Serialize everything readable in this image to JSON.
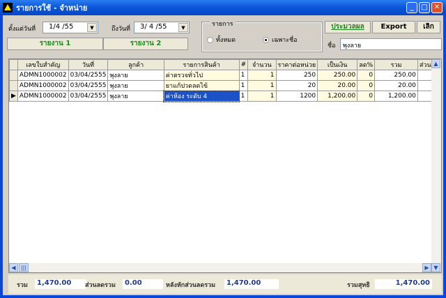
{
  "window": {
    "title": "รายการใช้ - จำหน่าย"
  },
  "filters": {
    "from_label": "ตั้งแต่วันที่",
    "from_value": "1/4 /55",
    "to_label": "ถึงวันที่",
    "to_value": "3/ 4 /55",
    "report1": "รายงาน 1",
    "report2": "รายงาน 2",
    "group_label": "รายการ",
    "radio_all": "ทั้งหมด",
    "radio_name": "เฉพาะชื่อ",
    "selected": "เฉพาะชื่อ",
    "process": "ประมวลผล",
    "export": "Export",
    "cancel": "เลิก",
    "name_label": "ชื่อ",
    "name_value": "พุงลาย"
  },
  "grid": {
    "columns": [
      "เลขใบสำคัญ",
      "วันที่",
      "ลูกค้า",
      "รายการสินค้า",
      "#",
      "จำนวน",
      "ราคาต่อหน่วย",
      "เป็นเงิน",
      "ลด%",
      "รวม",
      "ส่วนลด"
    ],
    "rows": [
      [
        "ADMN1000002",
        "03/04/2555",
        "พุงลาย",
        "ค่าตรวจทั่วไป",
        "1",
        "1",
        "250",
        "250.00",
        "0",
        "250.00",
        ""
      ],
      [
        "ADMN1000002",
        "03/04/2555",
        "พุงลาย",
        "ยาแก้ปวดลดไข้",
        "1",
        "1",
        "20",
        "20.00",
        "0",
        "20.00",
        ""
      ],
      [
        "ADMN1000002",
        "03/04/2555",
        "พุงลาย",
        "ค่าห้อง ระดับ 4",
        "1",
        "1",
        "1200",
        "1,200.00",
        "0",
        "1,200.00",
        ""
      ]
    ]
  },
  "footer": {
    "total_label": "รวม",
    "total": "1,470.00",
    "discount_label": "ส่วนลดรวม",
    "discount": "0.00",
    "after_label": "หลังหักส่วนลดรวม",
    "after": "1,470.00",
    "net_label": "รวมสุทธิ",
    "net": "1,470.00"
  }
}
